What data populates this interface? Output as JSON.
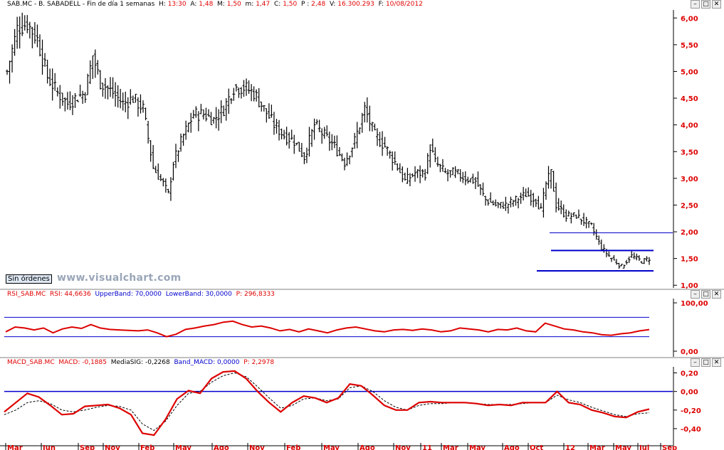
{
  "main_panel": {
    "header": {
      "symbol": "SAB.MC - B. SABADELL - Fin de día 1 semanas",
      "h_label": "H:",
      "h_value": "13:30",
      "a_label": "A:",
      "a_value": "1,48",
      "m_label": "M:",
      "m_value": "1,50",
      "mn_label": "m:",
      "mn_value": "1,47",
      "c_label": "C:",
      "c_value": "1,50",
      "p_label": "P :",
      "p_value": "2,48",
      "v_label": "V:",
      "v_value": "16.300.293",
      "f_label": "F:",
      "f_value": "10/08/2012"
    },
    "orders_button": "Sin órdenes",
    "watermark": "www.visualchart.com"
  },
  "rsi_panel": {
    "header": {
      "name": "RSI_SAB.MC",
      "rsi_label": "RSI:",
      "rsi_value": "44,6636",
      "upper_label": "UpperBand:",
      "upper_value": "70,0000",
      "lower_label": "LowerBand:",
      "lower_value": "30,0000",
      "p_label": "P:",
      "p_value": "296,8333"
    }
  },
  "macd_panel": {
    "header": {
      "name": "MACD_SAB.MC",
      "macd_label": "MACD:",
      "macd_value": "-0,1885",
      "sig_label": "MediaSIG:",
      "sig_value": "-0,2268",
      "band_label": "Band_MACD:",
      "band_value": "0,0000",
      "p_label": "P:",
      "p_value": "2,2978"
    }
  },
  "window_buttons": {
    "min": "–",
    "max": "□",
    "close": "✕"
  },
  "colors": {
    "price": "#000000",
    "rsi": "#dd0000",
    "macd": "#dd0000",
    "signal": "#000000",
    "bands": "#0000cc",
    "axis_text": "#dd0000"
  },
  "chart_data": [
    {
      "type": "bar",
      "subtype": "ohlc",
      "title": "SAB.MC - B. SABADELL - Fin de día 1 semanas",
      "ylim": [
        0.95,
        6.15
      ],
      "y_ticks": [
        6.0,
        5.5,
        5.0,
        4.5,
        4.0,
        3.5,
        3.0,
        2.5,
        2.0,
        1.5,
        1.0
      ],
      "y_tick_labels": [
        "6,00",
        "5,50",
        "5,00",
        "4,50",
        "4,00",
        "3,50",
        "3,00",
        "2,50",
        "2,00",
        "1,50",
        "1,00"
      ],
      "x_tick_labels": [
        "Mar",
        "Jun",
        "Sep",
        "Nov",
        "Feb",
        "May",
        "Ago",
        "Nov",
        "Feb",
        "May",
        "Ago",
        "Nov",
        "11",
        "Mar",
        "May",
        "Ago",
        "Oct",
        "12",
        "Mar",
        "May",
        "Jul",
        "Sep"
      ],
      "close_anchors": [
        [
          0,
          5.0
        ],
        [
          4,
          5.8
        ],
        [
          8,
          5.9
        ],
        [
          12,
          5.6
        ],
        [
          16,
          4.9
        ],
        [
          20,
          4.6
        ],
        [
          24,
          4.4
        ],
        [
          27,
          4.5
        ],
        [
          31,
          4.6
        ],
        [
          34,
          5.3
        ],
        [
          37,
          4.8
        ],
        [
          42,
          4.6
        ],
        [
          46,
          4.4
        ],
        [
          50,
          4.5
        ],
        [
          54,
          4.3
        ],
        [
          58,
          3.2
        ],
        [
          62,
          2.9
        ],
        [
          64,
          2.7
        ],
        [
          66,
          3.3
        ],
        [
          70,
          3.8
        ],
        [
          74,
          4.2
        ],
        [
          78,
          4.2
        ],
        [
          82,
          4.1
        ],
        [
          86,
          4.3
        ],
        [
          90,
          4.7
        ],
        [
          94,
          4.7
        ],
        [
          98,
          4.6
        ],
        [
          102,
          4.3
        ],
        [
          106,
          4.0
        ],
        [
          110,
          3.8
        ],
        [
          114,
          3.7
        ],
        [
          118,
          3.4
        ],
        [
          122,
          4.0
        ],
        [
          126,
          3.8
        ],
        [
          130,
          3.6
        ],
        [
          134,
          3.3
        ],
        [
          138,
          3.7
        ],
        [
          142,
          4.3
        ],
        [
          146,
          3.8
        ],
        [
          150,
          3.6
        ],
        [
          154,
          3.3
        ],
        [
          158,
          2.95
        ],
        [
          162,
          3.1
        ],
        [
          166,
          3.1
        ],
        [
          168,
          3.6
        ],
        [
          170,
          3.3
        ],
        [
          174,
          3.1
        ],
        [
          178,
          3.1
        ],
        [
          182,
          3.0
        ],
        [
          186,
          2.95
        ],
        [
          190,
          2.6
        ],
        [
          194,
          2.5
        ],
        [
          198,
          2.5
        ],
        [
          202,
          2.6
        ],
        [
          206,
          2.7
        ],
        [
          210,
          2.6
        ],
        [
          212,
          2.4
        ],
        [
          214,
          2.9
        ],
        [
          216,
          3.1
        ],
        [
          218,
          2.5
        ],
        [
          222,
          2.3
        ],
        [
          226,
          2.3
        ],
        [
          229,
          2.2
        ],
        [
          232,
          2.1
        ],
        [
          236,
          1.7
        ],
        [
          240,
          1.5
        ],
        [
          244,
          1.35
        ],
        [
          248,
          1.55
        ],
        [
          252,
          1.45
        ],
        [
          255,
          1.5
        ]
      ],
      "horizontal_lines": [
        1.98,
        1.65,
        1.27
      ],
      "data_note_hidden": ""
    },
    {
      "type": "line",
      "title": "RSI_SAB.MC",
      "series": [
        {
          "name": "RSI",
          "values": [
            40,
            50,
            48,
            44,
            48,
            38,
            46,
            50,
            47,
            55,
            48,
            45,
            44,
            43,
            42,
            44,
            38,
            30,
            35,
            45,
            48,
            52,
            55,
            60,
            62,
            55,
            50,
            52,
            48,
            42,
            45,
            40,
            46,
            42,
            38,
            44,
            48,
            50,
            46,
            42,
            40,
            44,
            45,
            43,
            46,
            44,
            40,
            42,
            48,
            46,
            44,
            40,
            45,
            44,
            48,
            42,
            40,
            58,
            52,
            46,
            44,
            40,
            38,
            34,
            33,
            36,
            38,
            42,
            44.66
          ]
        }
      ],
      "bands": [
        70,
        30
      ],
      "ylim": [
        0,
        100
      ],
      "y_tick_labels": [
        "100,00",
        "0,00"
      ]
    },
    {
      "type": "line",
      "title": "MACD_SAB.MC",
      "series": [
        {
          "name": "MACD",
          "values": [
            -0.22,
            -0.12,
            -0.02,
            -0.06,
            -0.15,
            -0.25,
            -0.24,
            -0.16,
            -0.15,
            -0.14,
            -0.18,
            -0.25,
            -0.45,
            -0.47,
            -0.3,
            -0.08,
            0.01,
            -0.02,
            0.14,
            0.21,
            0.22,
            0.14,
            0.0,
            -0.12,
            -0.22,
            -0.12,
            -0.05,
            -0.07,
            -0.12,
            -0.07,
            0.08,
            0.06,
            -0.04,
            -0.15,
            -0.2,
            -0.2,
            -0.12,
            -0.11,
            -0.12,
            -0.12,
            -0.12,
            -0.13,
            -0.15,
            -0.14,
            -0.15,
            -0.12,
            -0.12,
            -0.12,
            0.0,
            -0.12,
            -0.14,
            -0.2,
            -0.23,
            -0.27,
            -0.28,
            -0.22,
            -0.19
          ]
        },
        {
          "name": "MediaSIG",
          "values": [
            -0.25,
            -0.2,
            -0.12,
            -0.1,
            -0.13,
            -0.2,
            -0.22,
            -0.2,
            -0.17,
            -0.15,
            -0.16,
            -0.2,
            -0.35,
            -0.42,
            -0.32,
            -0.15,
            -0.02,
            0.0,
            0.1,
            0.17,
            0.2,
            0.16,
            0.05,
            -0.07,
            -0.18,
            -0.15,
            -0.08,
            -0.07,
            -0.1,
            -0.08,
            0.04,
            0.06,
            0.0,
            -0.1,
            -0.17,
            -0.2,
            -0.15,
            -0.13,
            -0.13,
            -0.12,
            -0.12,
            -0.13,
            -0.14,
            -0.14,
            -0.14,
            -0.13,
            -0.12,
            -0.12,
            -0.04,
            -0.09,
            -0.12,
            -0.17,
            -0.21,
            -0.25,
            -0.27,
            -0.24,
            -0.23
          ]
        }
      ],
      "zero_line": 0.0,
      "ylim": [
        -0.5,
        0.25
      ],
      "y_ticks": [
        0.2,
        0.0,
        -0.2,
        -0.4
      ],
      "y_tick_labels": [
        "0,20",
        "0,00",
        "-0,20",
        "-0,40"
      ]
    }
  ]
}
